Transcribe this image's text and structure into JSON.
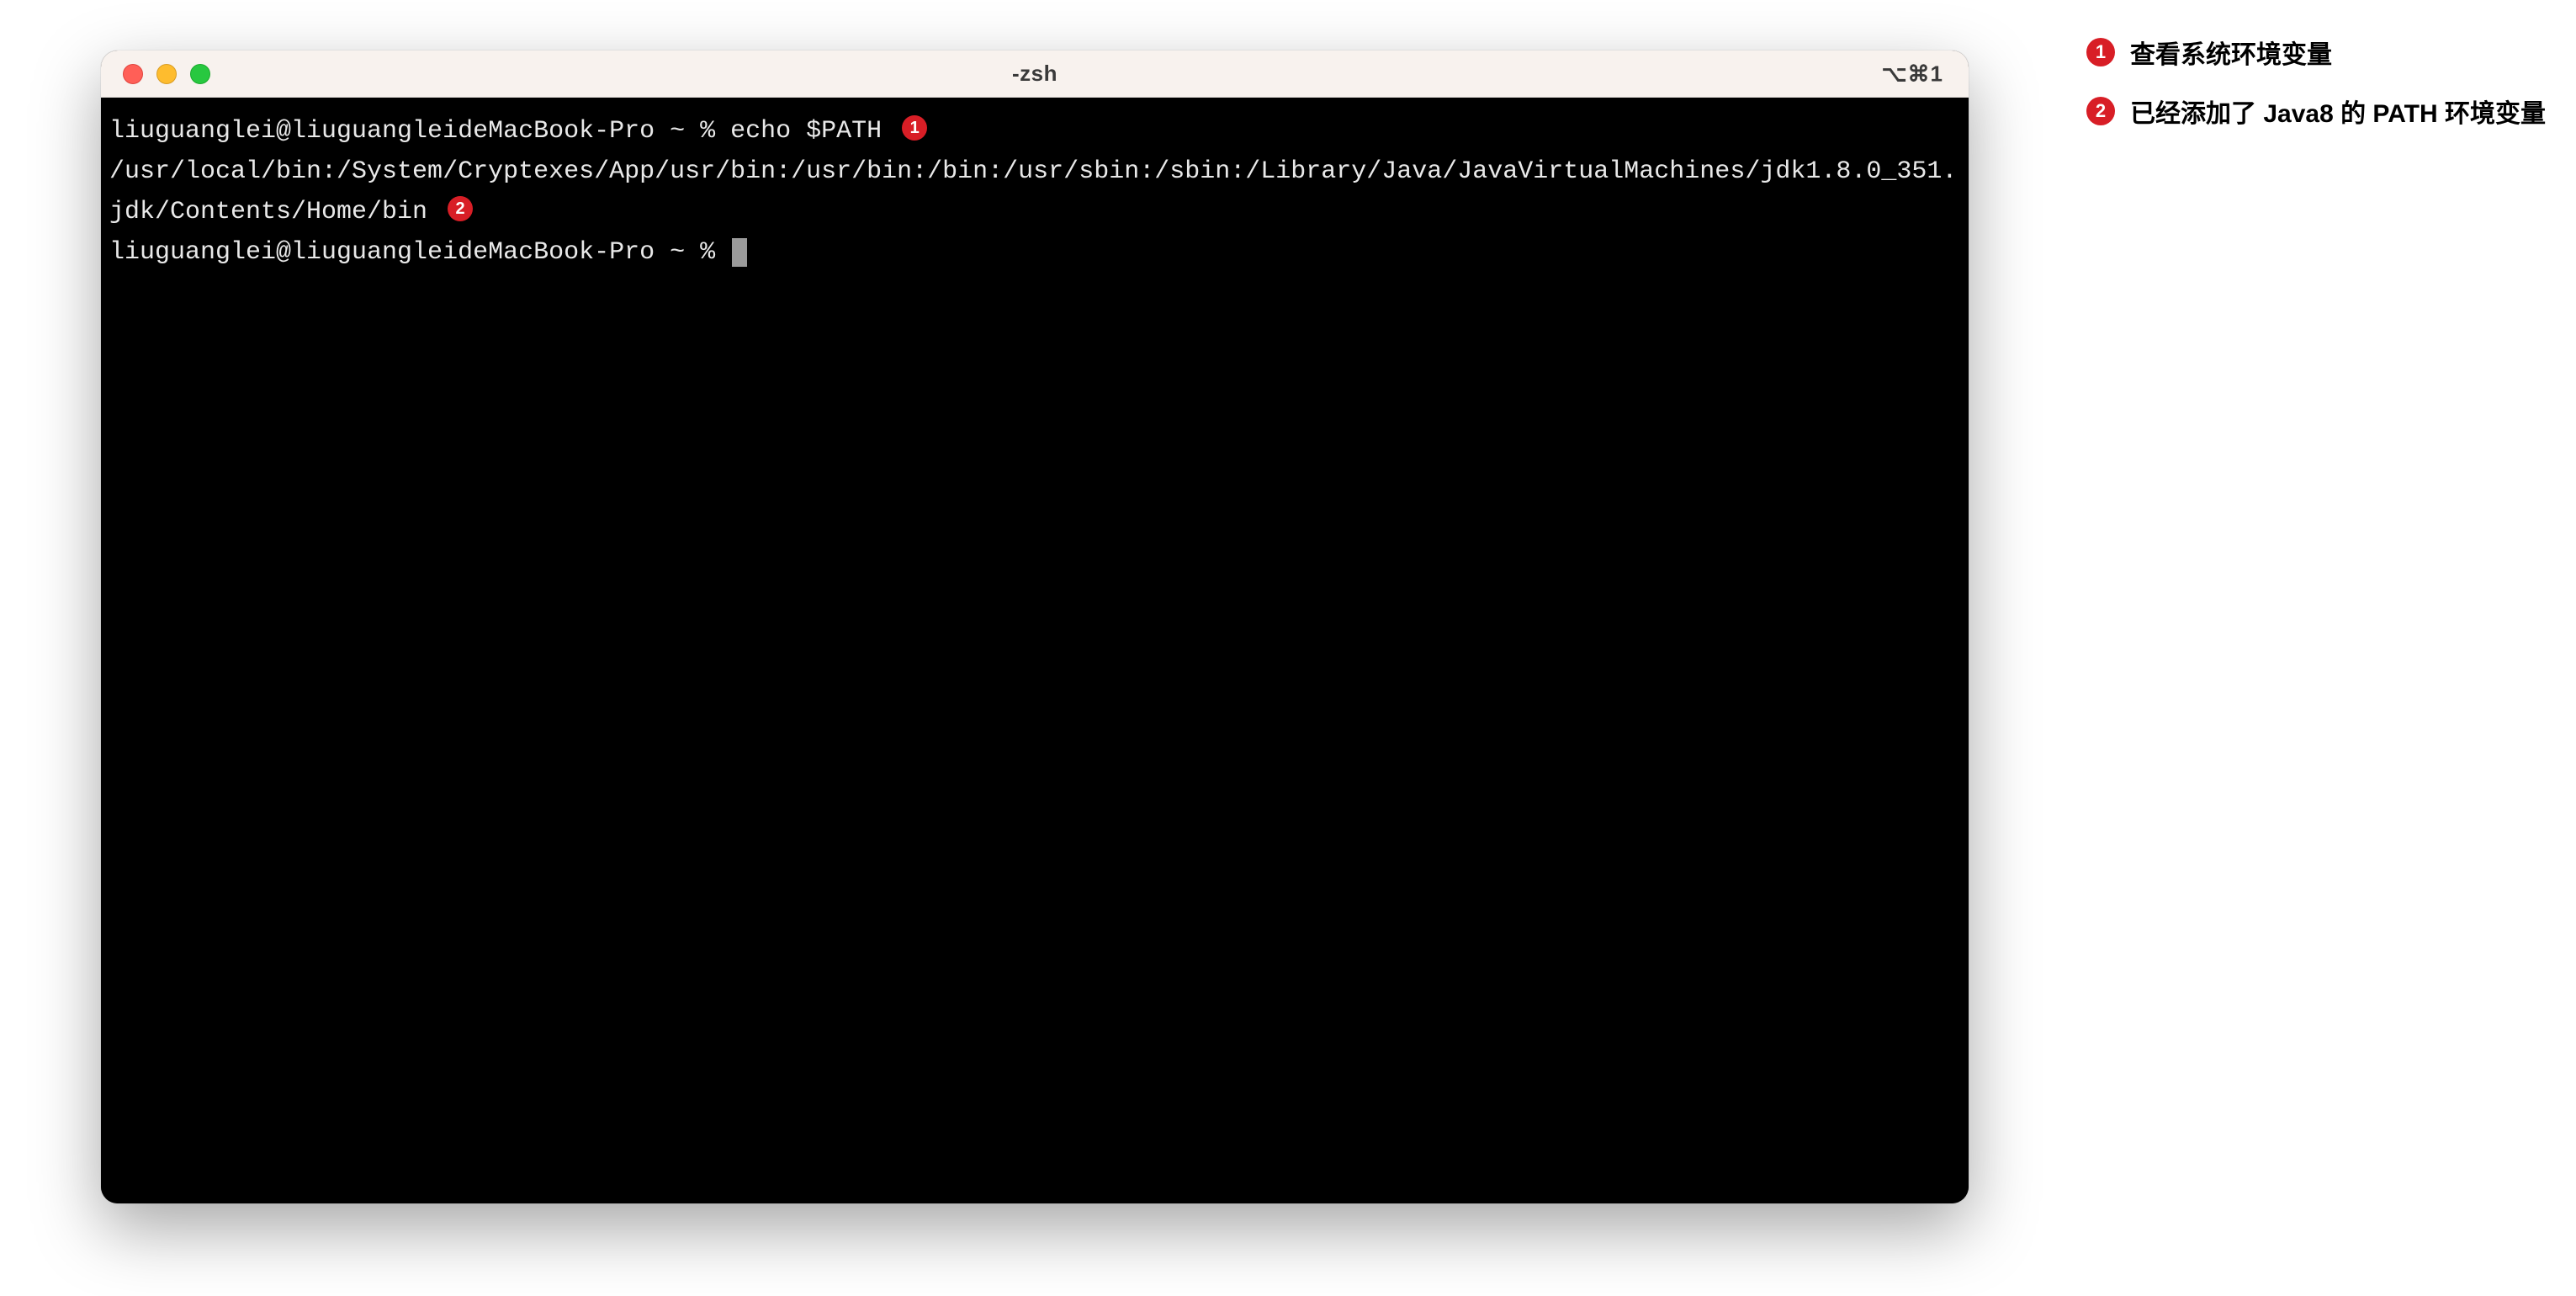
{
  "window": {
    "title": "-zsh",
    "shortcut": "⌥⌘1"
  },
  "terminal": {
    "prompt1_prefix": "liuguanglei@liuguangleideMacBook-Pro ~ % ",
    "command1": "echo $PATH",
    "badge1": "1",
    "output_line": "/usr/local/bin:/System/Cryptexes/App/usr/bin:/usr/bin:/bin:/usr/sbin:/sbin:/Library/Java/JavaVirtualMachines/jdk1.8.0_351.jdk/Contents/Home/bin",
    "badge2": "2",
    "prompt2_prefix": "liuguanglei@liuguangleideMacBook-Pro ~ % "
  },
  "annotations": [
    {
      "num": "1",
      "text": "查看系统环境变量"
    },
    {
      "num": "2",
      "text": "已经添加了 Java8 的 PATH 环境变量"
    }
  ]
}
